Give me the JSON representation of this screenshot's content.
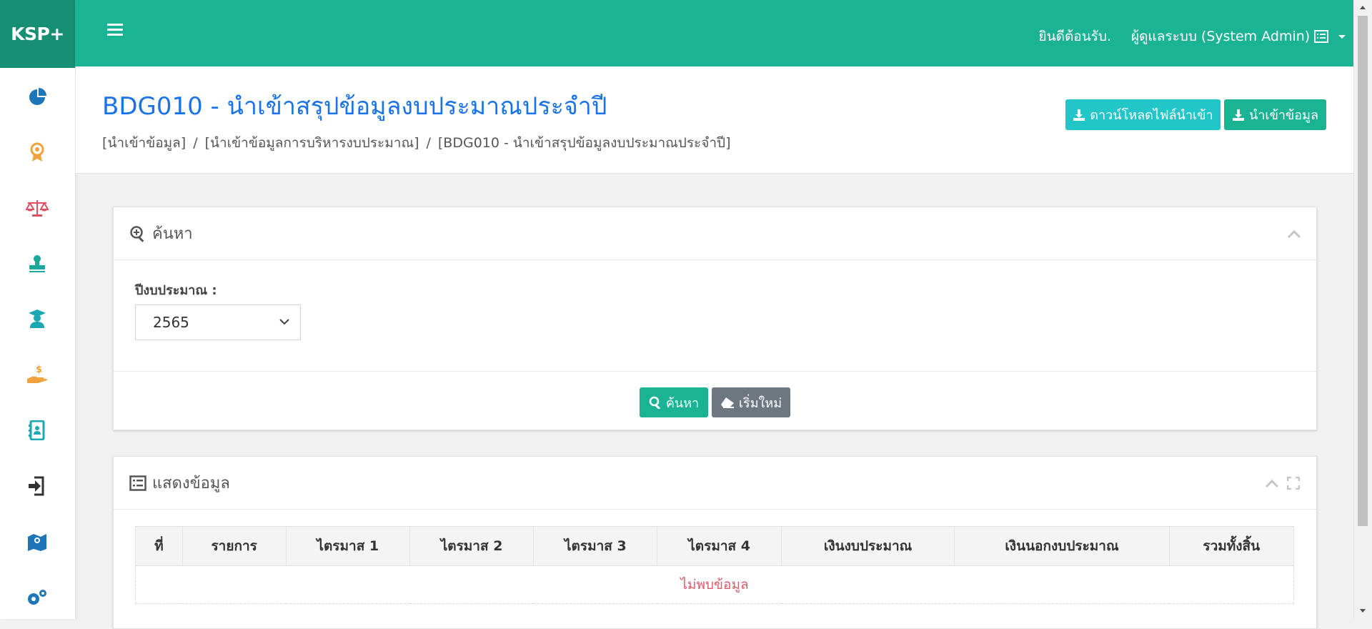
{
  "brand": "KSP+",
  "topbar": {
    "welcome": "ยินดีต้อนรับ.",
    "user_name": "ผู้ดูแลระบบ (System Admin)"
  },
  "page": {
    "title": "BDG010 - นำเข้าสรุปข้อมูลงบประมาณประจำปี",
    "breadcrumb": [
      "[นำเข้าข้อมูล]",
      "[นำเข้าข้อมูลการบริหารงบประมาณ]",
      "[BDG010 - นำเข้าสรุปข้อมูลงบประมาณประจำปี]"
    ],
    "breadcrumb_sep": "/",
    "download_label": "ดาวน์โหลดไฟล์นำเข้า",
    "import_label": "นำเข้าข้อมูล"
  },
  "sidebar_icons": [
    "chart-pie-icon",
    "award-icon",
    "balance-scale-icon",
    "stamp-icon",
    "graduate-icon",
    "money-hand-icon",
    "address-book-icon",
    "sign-in-icon",
    "map-icon",
    "settings-icon"
  ],
  "search": {
    "title": "ค้นหา",
    "year_label": "ปีงบประมาณ :",
    "year_value": "2565",
    "search_label": "ค้นหา",
    "reset_label": "เริ่มใหม่"
  },
  "results": {
    "title": "แสดงข้อมูล",
    "columns": [
      "ที่",
      "รายการ",
      "ไตรมาส 1",
      "ไตรมาส 2",
      "ไตรมาส 3",
      "ไตรมาส 4",
      "เงินงบประมาณ",
      "เงินนอกงบประมาณ",
      "รวมทั้งสิ้น"
    ],
    "empty_text": "ไม่พบข้อมูล"
  },
  "colors": {
    "primary": "#1ab394",
    "brand_dark": "#168f75",
    "info": "#23c6c8",
    "title_blue": "#1a73e8",
    "empty_red": "#e05a6d"
  }
}
